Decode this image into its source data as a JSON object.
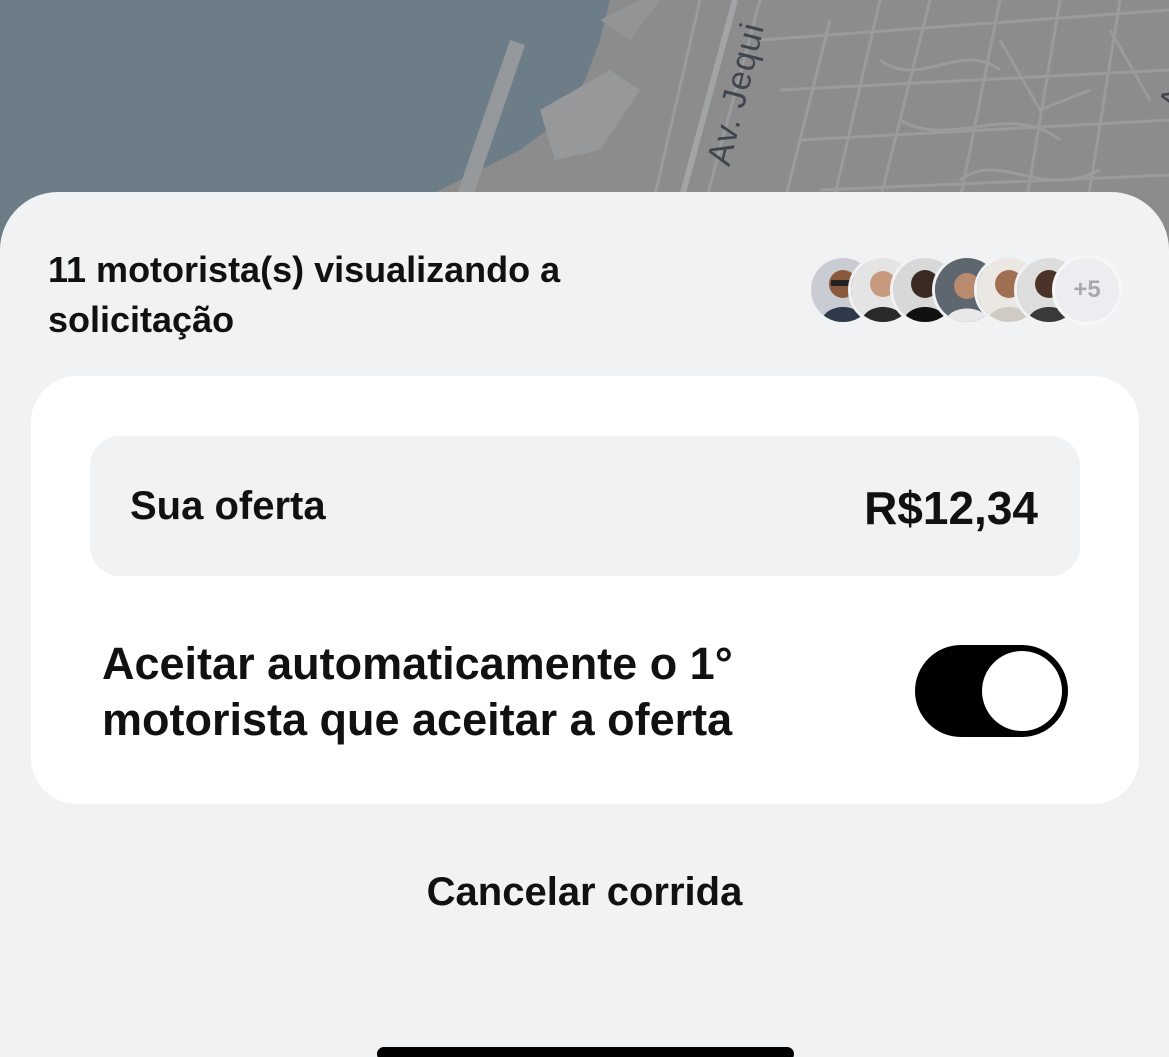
{
  "map": {
    "street_label": "Av. Jequi",
    "edge_label": "A"
  },
  "header": {
    "viewers_text": "11 motorista(s) visualizando a solicitação",
    "extra_drivers_label": "+5"
  },
  "offer": {
    "label": "Sua oferta",
    "value": "R$12,34"
  },
  "auto_accept": {
    "label": "Aceitar automaticamente o 1° motorista que aceitar a oferta",
    "enabled": true
  },
  "actions": {
    "cancel_label": "Cancelar corrida"
  },
  "colors": {
    "sheet_background": "#f1f2f4",
    "card_background": "#ffffff",
    "toggle_on": "#000000",
    "map_water": "#6c7d87",
    "map_land": "#8c8c8c"
  }
}
